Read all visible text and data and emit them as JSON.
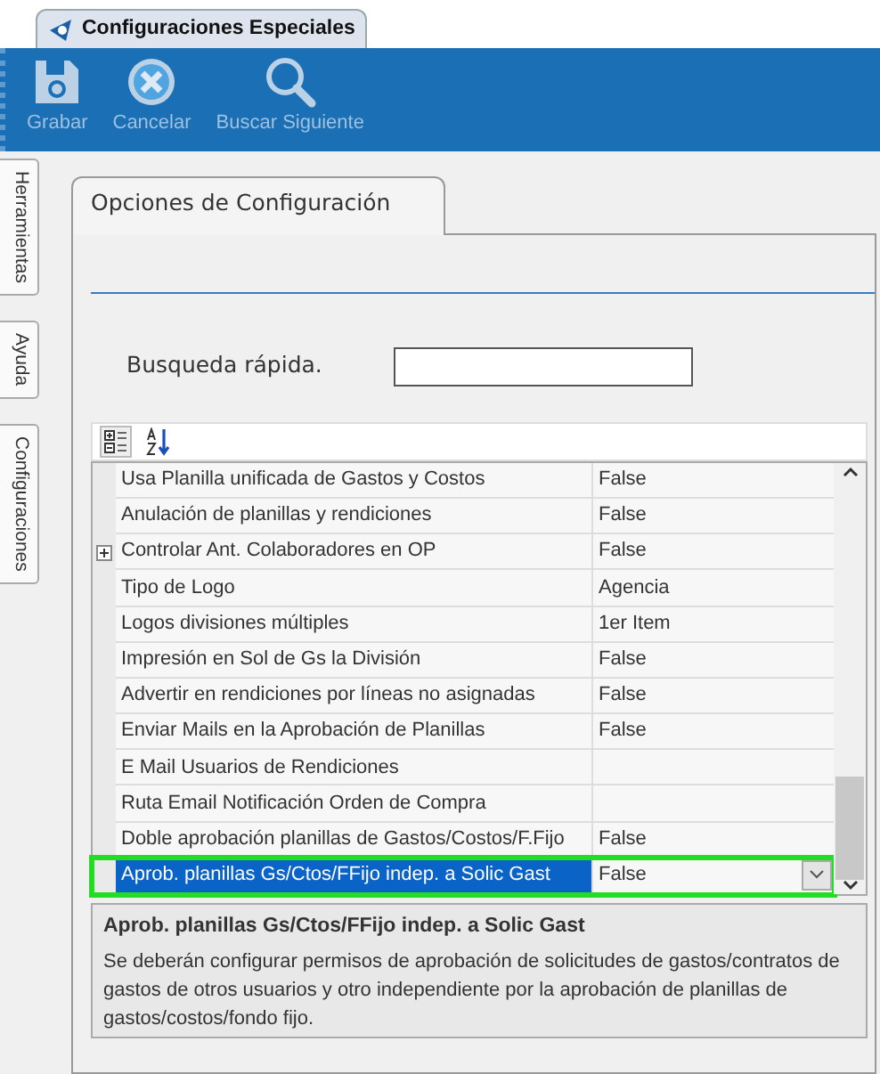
{
  "document_tab": {
    "title": "Configuraciones Especiales"
  },
  "toolbar": [
    {
      "label": "Grabar",
      "kind": "save",
      "disabled": true
    },
    {
      "label": "Cancelar",
      "kind": "cancel",
      "disabled": true
    },
    {
      "label": "Buscar Siguiente",
      "kind": "search",
      "disabled": true
    }
  ],
  "side_tabs": [
    {
      "label": "Herramientas"
    },
    {
      "label": "Ayuda"
    },
    {
      "label": "Configuraciones"
    }
  ],
  "panel": {
    "tab": "Opciones de Configuración",
    "search": {
      "label": "Busqueda rápida."
    }
  },
  "grid_toolbar": [
    {
      "kind": "categorized",
      "selected": true
    },
    {
      "kind": "alphabetical",
      "selected": false
    }
  ],
  "rows": [
    {
      "name": "Usa Planilla unificada de Gastos y Costos",
      "value": "False",
      "expandable": false,
      "selected": false
    },
    {
      "name": "Anulación de planillas y rendiciones",
      "value": "False",
      "expandable": false,
      "selected": false
    },
    {
      "name": "Controlar Ant. Colaboradores en OP",
      "value": "False",
      "expandable": true,
      "selected": false
    },
    {
      "name": "Tipo de Logo",
      "value": "Agencia",
      "expandable": false,
      "selected": false
    },
    {
      "name": "Logos divisiones múltiples",
      "value": "1er Item",
      "expandable": false,
      "selected": false
    },
    {
      "name": "Impresión en Sol de Gs la División",
      "value": "False",
      "expandable": false,
      "selected": false
    },
    {
      "name": "Advertir en rendiciones por líneas no asignadas",
      "value": "False",
      "expandable": false,
      "selected": false
    },
    {
      "name": "Enviar Mails en la Aprobación de Planillas",
      "value": "False",
      "expandable": false,
      "selected": false
    },
    {
      "name": "E Mail Usuarios de Rendiciones",
      "expandable": false,
      "selected": false
    },
    {
      "name": "Ruta Email Notificación Orden de Compra",
      "expandable": false,
      "selected": false
    },
    {
      "name": "Doble aprobación planillas de Gastos/Costos/F.Fijo",
      "value": "False",
      "expandable": false,
      "selected": false
    },
    {
      "name": "Aprob. planillas Gs/Ctos/FFijo indep. a Solic Gast",
      "value": "False",
      "expandable": false,
      "selected": true
    }
  ],
  "description": {
    "title": "Aprob. planillas Gs/Ctos/FFijo indep. a Solic Gast",
    "text": "Se deberán configurar permisos de aprobación de solicitudes de gastos/contratos de gastos de otros usuarios y otro independiente por la aprobación de planillas de gastos/costos/fondo fijo."
  }
}
